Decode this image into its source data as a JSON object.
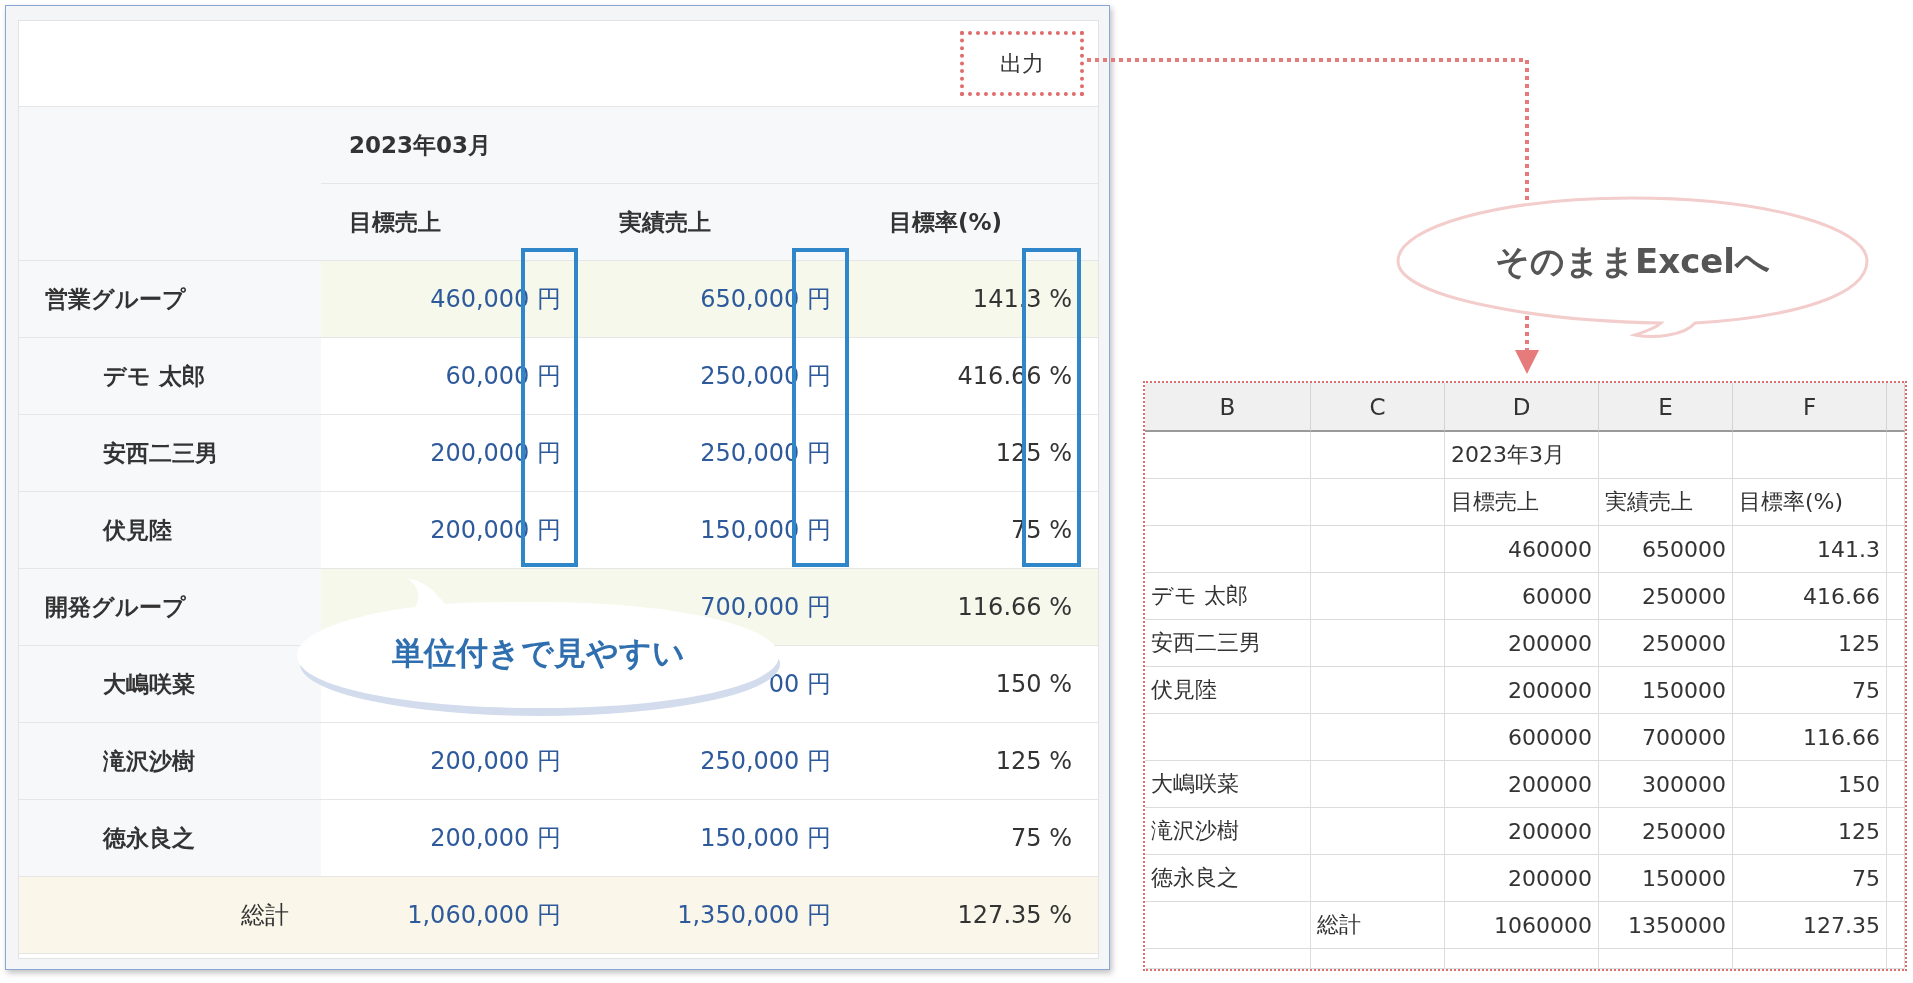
{
  "web_table": {
    "export_button": "出力",
    "period": "2023年03月",
    "columns": [
      "目標売上",
      "実績売上",
      "目標率(%)"
    ],
    "rows": [
      {
        "kind": "group",
        "label": "営業グループ",
        "target": "460,000 円",
        "actual": "650,000 円",
        "rate": "141.3 %"
      },
      {
        "kind": "member",
        "label": "デモ 太郎",
        "target": "60,000 円",
        "actual": "250,000 円",
        "rate": "416.66 %"
      },
      {
        "kind": "member",
        "label": "安西二三男",
        "target": "200,000 円",
        "actual": "250,000 円",
        "rate": "125 %"
      },
      {
        "kind": "member",
        "label": "伏見陸",
        "target": "200,000 円",
        "actual": "150,000 円",
        "rate": "75 %"
      },
      {
        "kind": "group",
        "label": "開発グループ",
        "actual": "700,000 円",
        "rate": "116.66 %"
      },
      {
        "kind": "member",
        "label": "大嶋咲菜",
        "actual": "00 円",
        "rate": "150 %"
      },
      {
        "kind": "member",
        "label": "滝沢沙樹",
        "target": "200,000 円",
        "actual": "250,000 円",
        "rate": "125 %"
      },
      {
        "kind": "member",
        "label": "徳永良之",
        "target": "200,000 円",
        "actual": "150,000 円",
        "rate": "75 %"
      },
      {
        "kind": "total",
        "label": "総計",
        "target": "1,060,000 円",
        "actual": "1,350,000 円",
        "rate": "127.35 %"
      }
    ]
  },
  "callouts": [
    {
      "text": "単位付きで見やすい"
    },
    {
      "text": "そのままExcelへ"
    }
  ],
  "excel": {
    "column_headers": [
      "B",
      "C",
      "D",
      "E",
      "F"
    ],
    "rows": [
      {
        "kind": "heading",
        "cells": [
          null,
          null,
          "2023年3月",
          null,
          null
        ]
      },
      {
        "kind": "heading",
        "cells": [
          null,
          null,
          "目標売上",
          "実績売上",
          "目標率(%)"
        ]
      },
      {
        "kind": "values",
        "cells": [
          null,
          null,
          "460000",
          "650000",
          "141.3"
        ]
      },
      {
        "kind": "values",
        "cells": [
          "デモ 太郎",
          null,
          "60000",
          "250000",
          "416.66"
        ]
      },
      {
        "kind": "values",
        "cells": [
          "安西二三男",
          null,
          "200000",
          "250000",
          "125"
        ]
      },
      {
        "kind": "values",
        "cells": [
          "伏見陸",
          null,
          "200000",
          "150000",
          "75"
        ]
      },
      {
        "kind": "values",
        "cells": [
          null,
          null,
          "600000",
          "700000",
          "116.66"
        ]
      },
      {
        "kind": "values",
        "cells": [
          "大嶋咲菜",
          null,
          "200000",
          "300000",
          "150"
        ]
      },
      {
        "kind": "values",
        "cells": [
          "滝沢沙樹",
          null,
          "200000",
          "250000",
          "125"
        ]
      },
      {
        "kind": "values",
        "cells": [
          "徳永良之",
          null,
          "200000",
          "150000",
          "75"
        ]
      },
      {
        "kind": "values",
        "cells": [
          null,
          "総計",
          "1060000",
          "1350000",
          "127.35"
        ]
      }
    ]
  }
}
